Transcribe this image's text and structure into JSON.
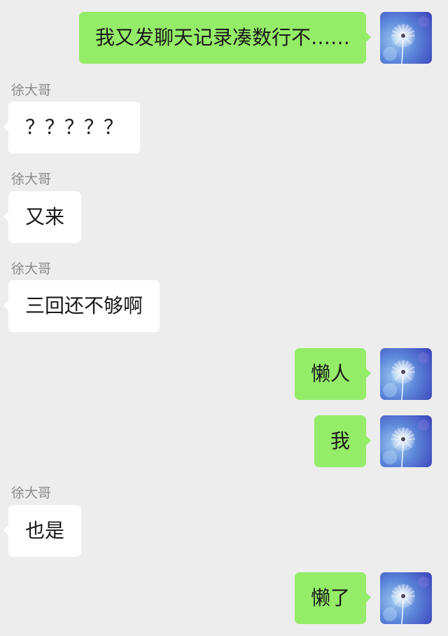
{
  "messages": [
    {
      "side": "out",
      "text": "我又发聊天记录凑数行不……",
      "avatar": "dandelion-avatar"
    },
    {
      "side": "in",
      "sender": "徐大哥",
      "text": "？？？？？"
    },
    {
      "side": "in",
      "sender": "徐大哥",
      "text": "又来"
    },
    {
      "side": "in",
      "sender": "徐大哥",
      "text": "三回还不够啊"
    },
    {
      "side": "out",
      "text": "懒人",
      "avatar": "dandelion-avatar"
    },
    {
      "side": "out",
      "text": "我",
      "avatar": "dandelion-avatar"
    },
    {
      "side": "in",
      "sender": "徐大哥",
      "text": "也是"
    },
    {
      "side": "out",
      "text": "懒了",
      "avatar": "dandelion-avatar"
    }
  ],
  "colors": {
    "background": "#ededed",
    "outgoing_bubble": "#95ec69",
    "incoming_bubble": "#ffffff",
    "sender_name": "#8a8a8a",
    "message_text": "#191919"
  }
}
